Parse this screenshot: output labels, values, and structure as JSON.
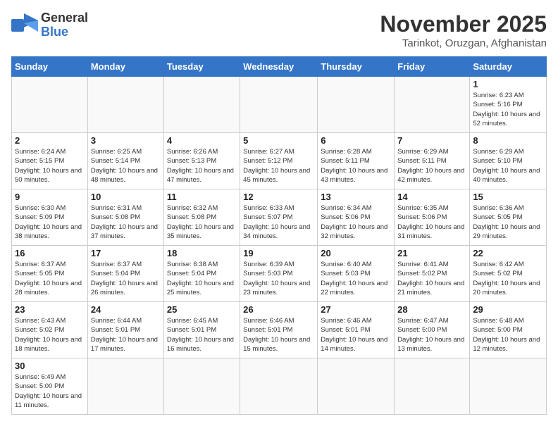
{
  "logo": {
    "text_general": "General",
    "text_blue": "Blue"
  },
  "header": {
    "month_year": "November 2025",
    "location": "Tarinkot, Oruzgan, Afghanistan"
  },
  "weekdays": [
    "Sunday",
    "Monday",
    "Tuesday",
    "Wednesday",
    "Thursday",
    "Friday",
    "Saturday"
  ],
  "weeks": [
    [
      {
        "day": "",
        "info": ""
      },
      {
        "day": "",
        "info": ""
      },
      {
        "day": "",
        "info": ""
      },
      {
        "day": "",
        "info": ""
      },
      {
        "day": "",
        "info": ""
      },
      {
        "day": "",
        "info": ""
      },
      {
        "day": "1",
        "info": "Sunrise: 6:23 AM\nSunset: 5:16 PM\nDaylight: 10 hours and 52 minutes."
      }
    ],
    [
      {
        "day": "2",
        "info": "Sunrise: 6:24 AM\nSunset: 5:15 PM\nDaylight: 10 hours and 50 minutes."
      },
      {
        "day": "3",
        "info": "Sunrise: 6:25 AM\nSunset: 5:14 PM\nDaylight: 10 hours and 48 minutes."
      },
      {
        "day": "4",
        "info": "Sunrise: 6:26 AM\nSunset: 5:13 PM\nDaylight: 10 hours and 47 minutes."
      },
      {
        "day": "5",
        "info": "Sunrise: 6:27 AM\nSunset: 5:12 PM\nDaylight: 10 hours and 45 minutes."
      },
      {
        "day": "6",
        "info": "Sunrise: 6:28 AM\nSunset: 5:11 PM\nDaylight: 10 hours and 43 minutes."
      },
      {
        "day": "7",
        "info": "Sunrise: 6:29 AM\nSunset: 5:11 PM\nDaylight: 10 hours and 42 minutes."
      },
      {
        "day": "8",
        "info": "Sunrise: 6:29 AM\nSunset: 5:10 PM\nDaylight: 10 hours and 40 minutes."
      }
    ],
    [
      {
        "day": "9",
        "info": "Sunrise: 6:30 AM\nSunset: 5:09 PM\nDaylight: 10 hours and 38 minutes."
      },
      {
        "day": "10",
        "info": "Sunrise: 6:31 AM\nSunset: 5:08 PM\nDaylight: 10 hours and 37 minutes."
      },
      {
        "day": "11",
        "info": "Sunrise: 6:32 AM\nSunset: 5:08 PM\nDaylight: 10 hours and 35 minutes."
      },
      {
        "day": "12",
        "info": "Sunrise: 6:33 AM\nSunset: 5:07 PM\nDaylight: 10 hours and 34 minutes."
      },
      {
        "day": "13",
        "info": "Sunrise: 6:34 AM\nSunset: 5:06 PM\nDaylight: 10 hours and 32 minutes."
      },
      {
        "day": "14",
        "info": "Sunrise: 6:35 AM\nSunset: 5:06 PM\nDaylight: 10 hours and 31 minutes."
      },
      {
        "day": "15",
        "info": "Sunrise: 6:36 AM\nSunset: 5:05 PM\nDaylight: 10 hours and 29 minutes."
      }
    ],
    [
      {
        "day": "16",
        "info": "Sunrise: 6:37 AM\nSunset: 5:05 PM\nDaylight: 10 hours and 28 minutes."
      },
      {
        "day": "17",
        "info": "Sunrise: 6:37 AM\nSunset: 5:04 PM\nDaylight: 10 hours and 26 minutes."
      },
      {
        "day": "18",
        "info": "Sunrise: 6:38 AM\nSunset: 5:04 PM\nDaylight: 10 hours and 25 minutes."
      },
      {
        "day": "19",
        "info": "Sunrise: 6:39 AM\nSunset: 5:03 PM\nDaylight: 10 hours and 23 minutes."
      },
      {
        "day": "20",
        "info": "Sunrise: 6:40 AM\nSunset: 5:03 PM\nDaylight: 10 hours and 22 minutes."
      },
      {
        "day": "21",
        "info": "Sunrise: 6:41 AM\nSunset: 5:02 PM\nDaylight: 10 hours and 21 minutes."
      },
      {
        "day": "22",
        "info": "Sunrise: 6:42 AM\nSunset: 5:02 PM\nDaylight: 10 hours and 20 minutes."
      }
    ],
    [
      {
        "day": "23",
        "info": "Sunrise: 6:43 AM\nSunset: 5:02 PM\nDaylight: 10 hours and 18 minutes."
      },
      {
        "day": "24",
        "info": "Sunrise: 6:44 AM\nSunset: 5:01 PM\nDaylight: 10 hours and 17 minutes."
      },
      {
        "day": "25",
        "info": "Sunrise: 6:45 AM\nSunset: 5:01 PM\nDaylight: 10 hours and 16 minutes."
      },
      {
        "day": "26",
        "info": "Sunrise: 6:46 AM\nSunset: 5:01 PM\nDaylight: 10 hours and 15 minutes."
      },
      {
        "day": "27",
        "info": "Sunrise: 6:46 AM\nSunset: 5:01 PM\nDaylight: 10 hours and 14 minutes."
      },
      {
        "day": "28",
        "info": "Sunrise: 6:47 AM\nSunset: 5:00 PM\nDaylight: 10 hours and 13 minutes."
      },
      {
        "day": "29",
        "info": "Sunrise: 6:48 AM\nSunset: 5:00 PM\nDaylight: 10 hours and 12 minutes."
      }
    ],
    [
      {
        "day": "30",
        "info": "Sunrise: 6:49 AM\nSunset: 5:00 PM\nDaylight: 10 hours and 11 minutes."
      },
      {
        "day": "",
        "info": ""
      },
      {
        "day": "",
        "info": ""
      },
      {
        "day": "",
        "info": ""
      },
      {
        "day": "",
        "info": ""
      },
      {
        "day": "",
        "info": ""
      },
      {
        "day": "",
        "info": ""
      }
    ]
  ]
}
